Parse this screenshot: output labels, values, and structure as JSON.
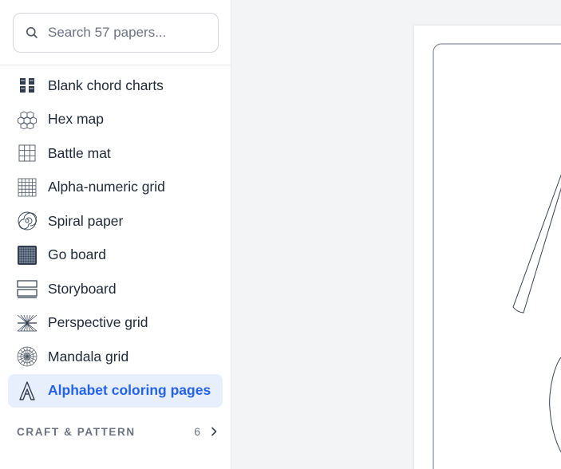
{
  "search": {
    "placeholder": "Search 57 papers..."
  },
  "papers": [
    {
      "label": "Blank chord charts",
      "icon": "chord-chart-icon"
    },
    {
      "label": "Hex map",
      "icon": "hex-map-icon"
    },
    {
      "label": "Battle mat",
      "icon": "battle-mat-icon"
    },
    {
      "label": "Alpha-numeric grid",
      "icon": "alpha-numeric-grid-icon"
    },
    {
      "label": "Spiral paper",
      "icon": "spiral-icon"
    },
    {
      "label": "Go board",
      "icon": "go-board-icon"
    },
    {
      "label": "Storyboard",
      "icon": "storyboard-icon"
    },
    {
      "label": "Perspective grid",
      "icon": "perspective-grid-icon"
    },
    {
      "label": "Mandala grid",
      "icon": "mandala-icon"
    },
    {
      "label": "Alphabet coloring pages",
      "icon": "letter-a-icon",
      "active": true
    }
  ],
  "section": {
    "label": "CRAFT & PATTERN",
    "count": "6"
  },
  "colors": {
    "accent": "#2563eb",
    "active_bg": "#e8effc",
    "icon_dark": "#2f3d4f"
  }
}
